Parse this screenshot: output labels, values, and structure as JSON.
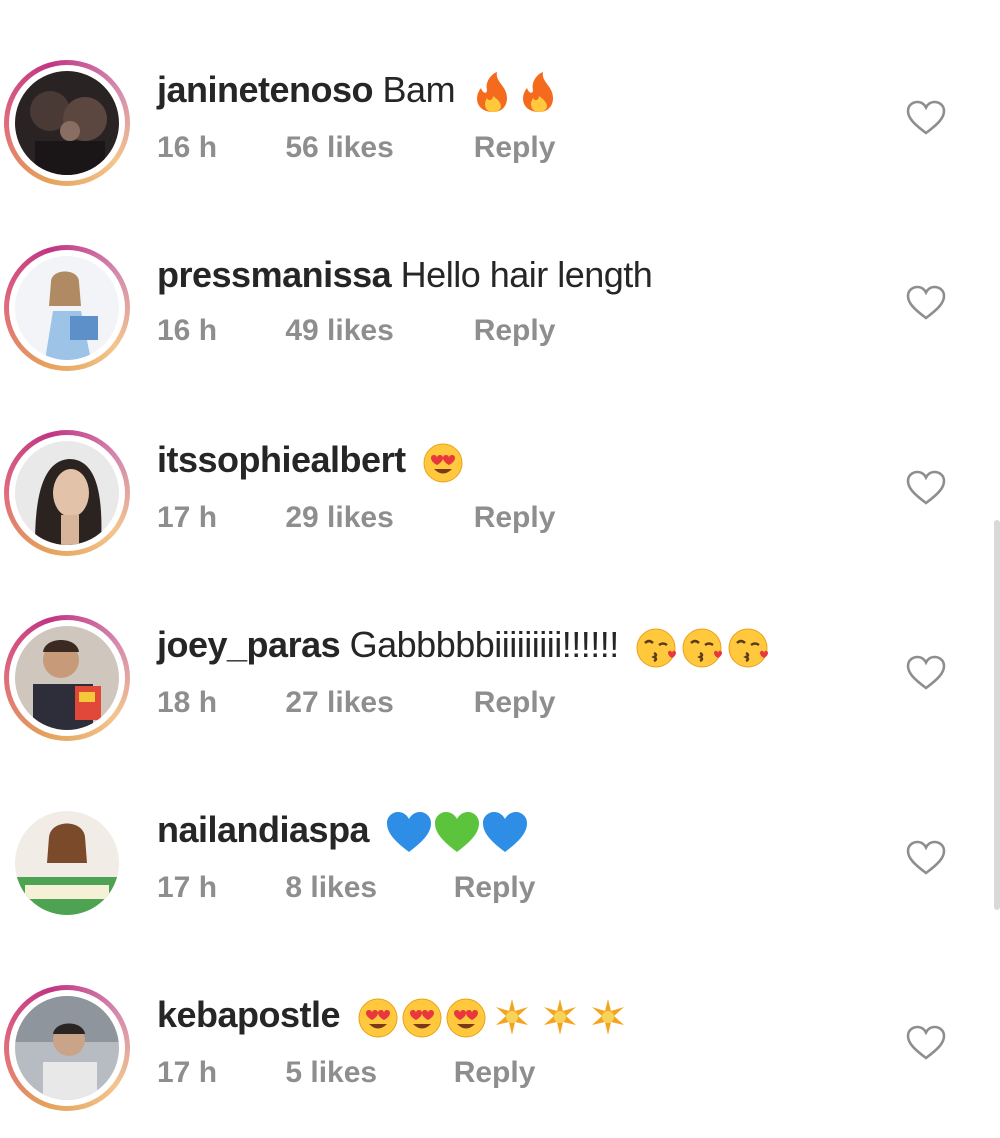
{
  "comments": [
    {
      "username": "janinetenoso",
      "text": "Bam",
      "emojis": [
        "fire-emoji",
        "fire-emoji"
      ],
      "time": "16 h",
      "likes": "56 likes",
      "reply": "Reply",
      "has_story_ring": true,
      "avatar_icon": "avatar-dark-photo-icon"
    },
    {
      "username": "pressmanissa",
      "text": "Hello hair length",
      "emojis": [],
      "time": "16 h",
      "likes": "49 likes",
      "reply": "Reply",
      "has_story_ring": true,
      "avatar_icon": "avatar-light-photo-icon"
    },
    {
      "username": "itssophiealbert",
      "text": "",
      "emojis": [
        "heart-eyes-emoji"
      ],
      "time": "17 h",
      "likes": "29 likes",
      "reply": "Reply",
      "has_story_ring": true,
      "avatar_icon": "avatar-portrait-photo-icon"
    },
    {
      "username": "joey_paras",
      "text": "Gabbbbbiiiiiiiii!!!!!!",
      "emojis": [
        "kiss-emoji",
        "kiss-emoji",
        "kiss-emoji"
      ],
      "time": "18 h",
      "likes": "27 likes",
      "reply": "Reply",
      "has_story_ring": true,
      "avatar_icon": "avatar-colorful-photo-icon"
    },
    {
      "username": "nailandiaspa",
      "text": "",
      "emojis": [
        "blue-heart-emoji",
        "green-heart-emoji",
        "blue-heart-emoji"
      ],
      "time": "17 h",
      "likes": "8 likes",
      "reply": "Reply",
      "has_story_ring": false,
      "avatar_icon": "avatar-spa-photo-icon"
    },
    {
      "username": "kebapostle",
      "text": "",
      "emojis": [
        "heart-eyes-emoji",
        "heart-eyes-emoji",
        "heart-eyes-emoji",
        "sparkle-emoji",
        "sparkle-emoji",
        "sparkle-emoji"
      ],
      "time": "17 h",
      "likes": "5 likes",
      "reply": "Reply",
      "has_story_ring": true,
      "avatar_icon": "avatar-grey-photo-icon"
    }
  ],
  "colors": {
    "username": "#262626",
    "meta": "#8e8e8e",
    "heart_outline": "#8e8e8e",
    "ring_gradient": [
      "#e4a15a",
      "#e06a7d",
      "#c13584"
    ]
  }
}
